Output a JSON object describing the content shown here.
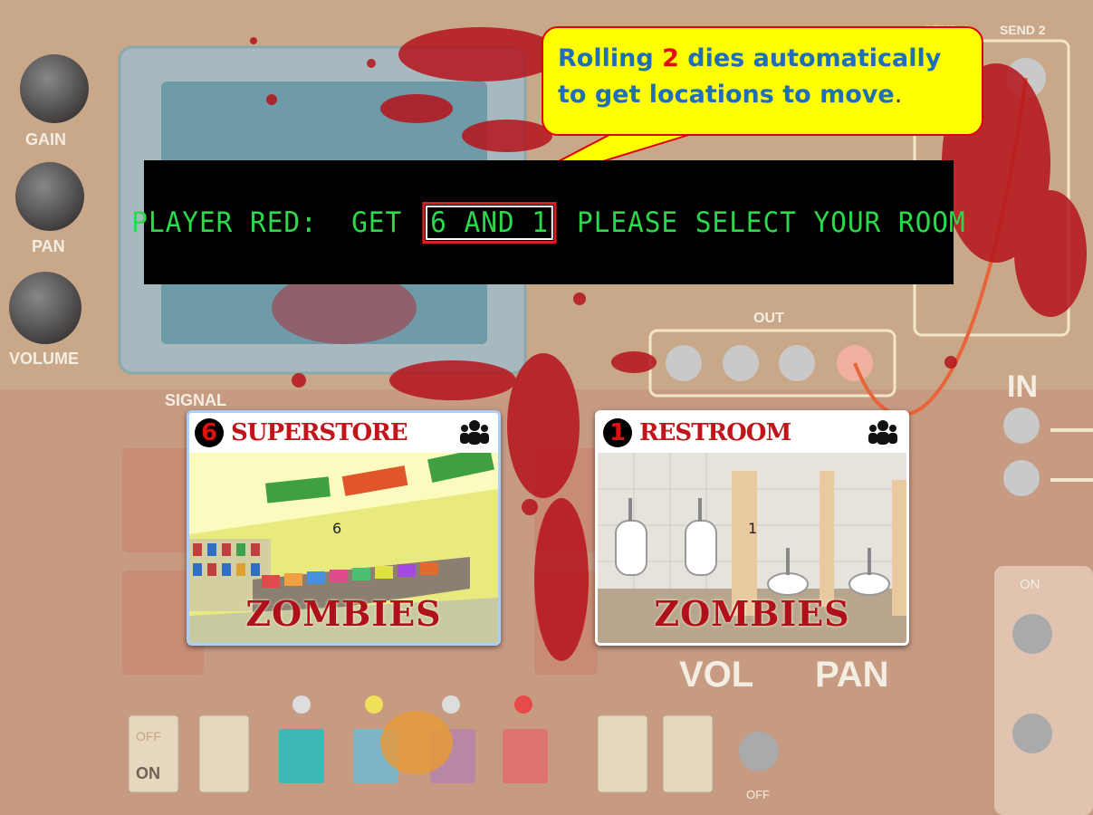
{
  "panel": {
    "labels": [
      "GAIN",
      "PAN",
      "VOLUME",
      "SIGNAL",
      "OUT",
      "IN",
      "SEND 2",
      "SEND 1",
      "VOL",
      "PAN",
      "ON",
      "OFF"
    ],
    "switch_labels": [
      "OFF",
      "ON"
    ]
  },
  "banner": {
    "prefix": "PLAYER RED:  GET ",
    "dice": "6 AND 1",
    "suffix": " PLEASE SELECT YOUR ROOM"
  },
  "callout": {
    "line1_pre": "Rolling ",
    "number": "2",
    "line1_post": " dies automatically",
    "line2": "to get locations to move",
    "period": "."
  },
  "cards": [
    {
      "number": "6",
      "name": "SUPERSTORE",
      "footer": "ZOMBIES",
      "marker": "6",
      "icon": "people-icon"
    },
    {
      "number": "1",
      "name": "RESTROOM",
      "footer": "ZOMBIES",
      "marker": "1",
      "icon": "people-icon"
    }
  ],
  "colors": {
    "banner_text": "#2bd94a",
    "callout_bg": "#ffff00",
    "callout_text": "#1f6fb8",
    "accent_red": "#e01010"
  }
}
